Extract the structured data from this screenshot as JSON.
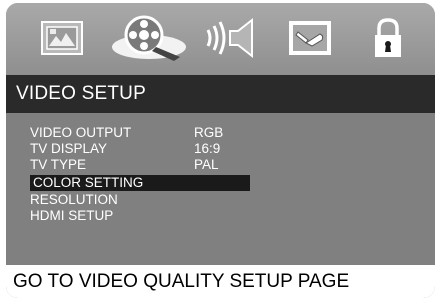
{
  "icons": [
    {
      "name": "general-setup-icon"
    },
    {
      "name": "video-setup-icon",
      "selected": true
    },
    {
      "name": "audio-setup-icon"
    },
    {
      "name": "preference-setup-icon"
    },
    {
      "name": "password-lock-icon"
    }
  ],
  "title": "VIDEO SETUP",
  "menu": {
    "items": [
      {
        "label": "VIDEO OUTPUT",
        "value": "RGB"
      },
      {
        "label": "TV DISPLAY",
        "value": "16:9"
      },
      {
        "label": "TV TYPE",
        "value": "PAL"
      },
      {
        "label": "COLOR SETTING",
        "value": "",
        "selected": true
      },
      {
        "label": "RESOLUTION",
        "value": ""
      },
      {
        "label": "HDMI SETUP",
        "value": ""
      }
    ]
  },
  "footer": "GO TO VIDEO QUALITY SETUP PAGE"
}
